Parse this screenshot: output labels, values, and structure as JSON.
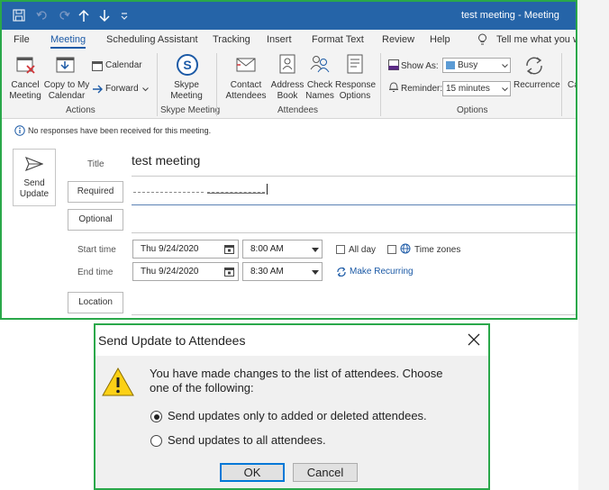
{
  "window": {
    "title": "test meeting  -  Meeting",
    "qat_icons": [
      "save-icon",
      "undo-icon",
      "redo-icon",
      "up-arrow-icon",
      "down-arrow-icon",
      "customize-icon"
    ]
  },
  "menu": {
    "items": [
      "File",
      "Meeting",
      "Scheduling Assistant",
      "Tracking",
      "Insert",
      "Format Text",
      "Review",
      "Help"
    ],
    "active": "Meeting",
    "tell_me": "Tell me what you wa"
  },
  "ribbon": {
    "actions": {
      "cancel_line1": "Cancel",
      "cancel_line2": "Meeting",
      "copy_line1": "Copy to My",
      "copy_line2": "Calendar",
      "calendar": "Calendar",
      "forward": "Forward",
      "group": "Actions"
    },
    "skype": {
      "line1": "Skype",
      "line2": "Meeting",
      "group": "Skype Meeting"
    },
    "attendees": {
      "contact_line1": "Contact",
      "contact_line2": "Attendees",
      "address_line1": "Address",
      "address_line2": "Book",
      "check_line1": "Check",
      "check_line2": "Names",
      "response_line1": "Response",
      "response_line2": "Options",
      "group": "Attendees"
    },
    "options": {
      "show_as_label": "Show As:",
      "show_as_value": "Busy",
      "reminder_label": "Reminder:",
      "reminder_value": "15 minutes",
      "recurrence": "Recurrence",
      "group": "Options",
      "cut_label": "Ca"
    }
  },
  "info": {
    "message": "No responses have been received for this meeting."
  },
  "form": {
    "send_line1": "Send",
    "send_line2": "Update",
    "title_label": "Title",
    "title_value": "test meeting",
    "required_label": "Required",
    "optional_label": "Optional",
    "start_label": "Start time",
    "start_date": "Thu 9/24/2020",
    "start_time": "8:00 AM",
    "end_label": "End time",
    "end_date": "Thu 9/24/2020",
    "end_time": "8:30 AM",
    "all_day": "All day",
    "time_zones": "Time zones",
    "make_recurring": "Make Recurring",
    "location_label": "Location"
  },
  "dialog": {
    "title": "Send Update to Attendees",
    "message_line1": "You have made changes to the list of attendees. Choose",
    "message_line2": "one of the following:",
    "option1": "Send updates only to added or deleted attendees.",
    "option2": "Send updates to all attendees.",
    "selected_option": 1,
    "ok": "OK",
    "cancel": "Cancel"
  },
  "colors": {
    "accent": "#2564a8",
    "highlight_border": "#2aa84a",
    "link": "#1c5aa6"
  }
}
